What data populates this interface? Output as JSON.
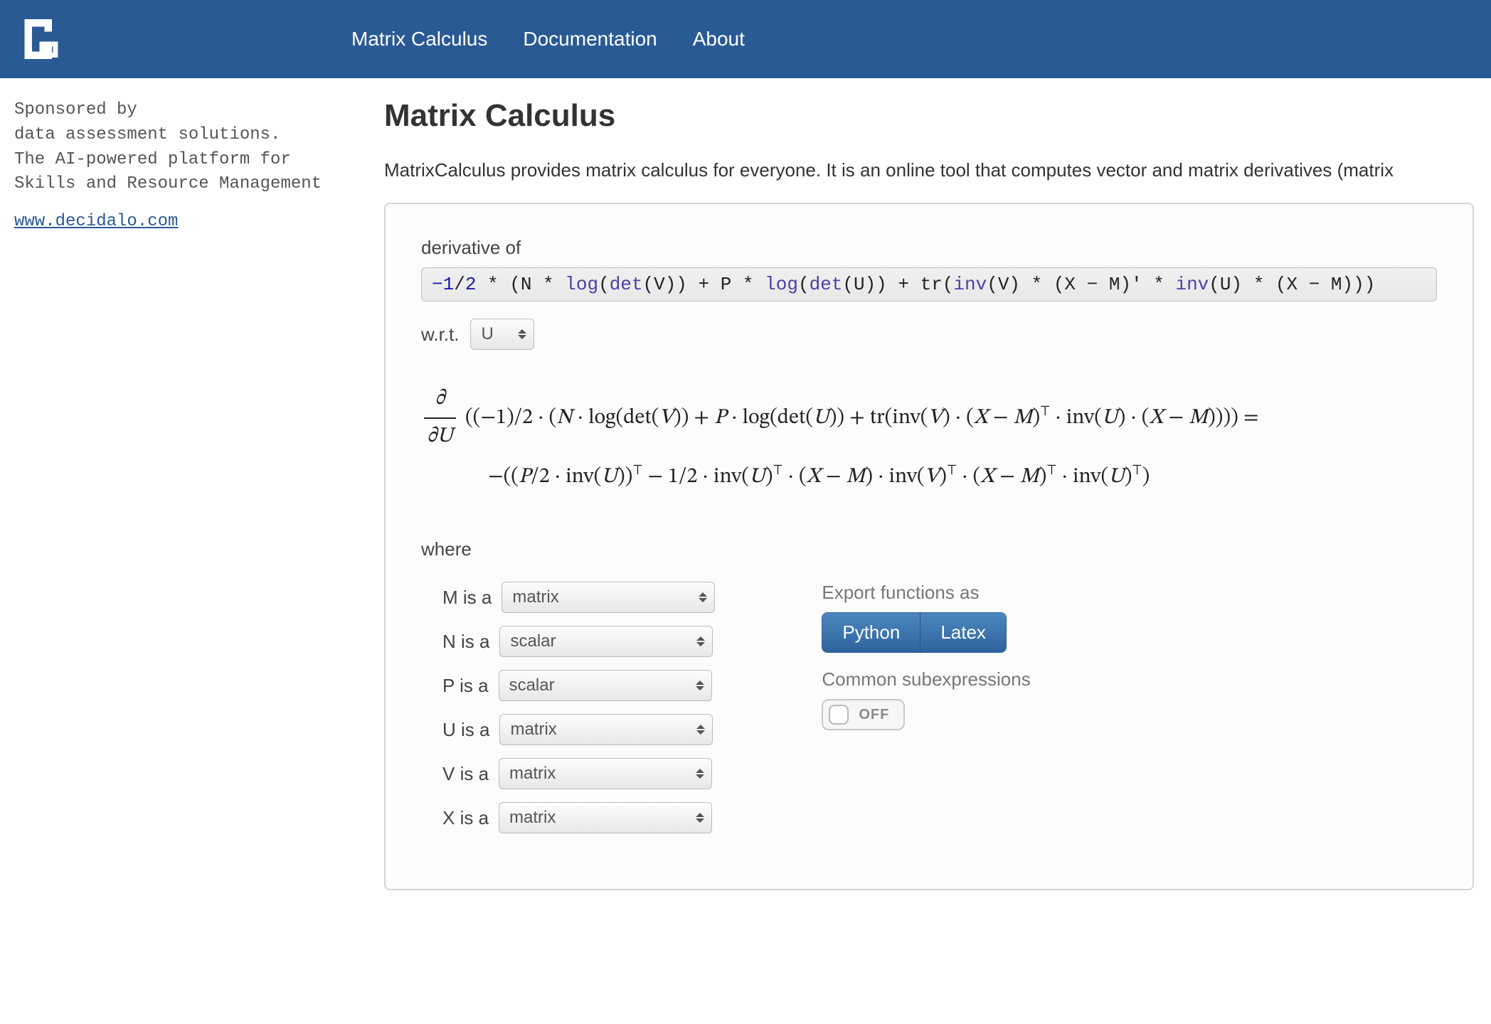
{
  "nav": {
    "items": [
      "Matrix Calculus",
      "Documentation",
      "About"
    ]
  },
  "sidebar": {
    "line1": "Sponsored by",
    "line2": "data assessment solutions.",
    "line3": "The AI-powered platform for",
    "line4": "Skills and Resource Management",
    "link": "www.decidalo.com"
  },
  "page": {
    "title": "Matrix Calculus",
    "intro": "MatrixCalculus provides matrix calculus for everyone. It is an online tool that computes vector and matrix derivatives (matrix"
  },
  "calc": {
    "derivative_label": "derivative of",
    "expression": "-1/2 * (N * log(det(V)) + P * log(det(U)) + tr(inv(V) * (X - M)' * inv(U) * (X - M)))",
    "wrt_label": "w.r.t.",
    "wrt_value": "U",
    "where_label": "where",
    "variables": [
      {
        "name": "M",
        "type": "matrix"
      },
      {
        "name": "N",
        "type": "scalar"
      },
      {
        "name": "P",
        "type": "scalar"
      },
      {
        "name": "U",
        "type": "matrix"
      },
      {
        "name": "V",
        "type": "matrix"
      },
      {
        "name": "X",
        "type": "matrix"
      }
    ],
    "result_line1": "((−1)/2 · (N · log(det(V)) + P · log(det(U)) + tr(inv(V) · (X − M)⊤ · inv(U) · (X − M)))) =",
    "result_line2": "−((P/2 · inv(U))⊤ − 1/2 · inv(U)⊤ · (X − M) · inv(V)⊤ · (X − M)⊤ · inv(U)⊤)",
    "partial_top": "∂",
    "partial_bot": "∂U"
  },
  "export": {
    "label": "Export functions as",
    "buttons": [
      "Python",
      "Latex"
    ],
    "cse_label": "Common subexpressions",
    "toggle_text": "OFF"
  }
}
